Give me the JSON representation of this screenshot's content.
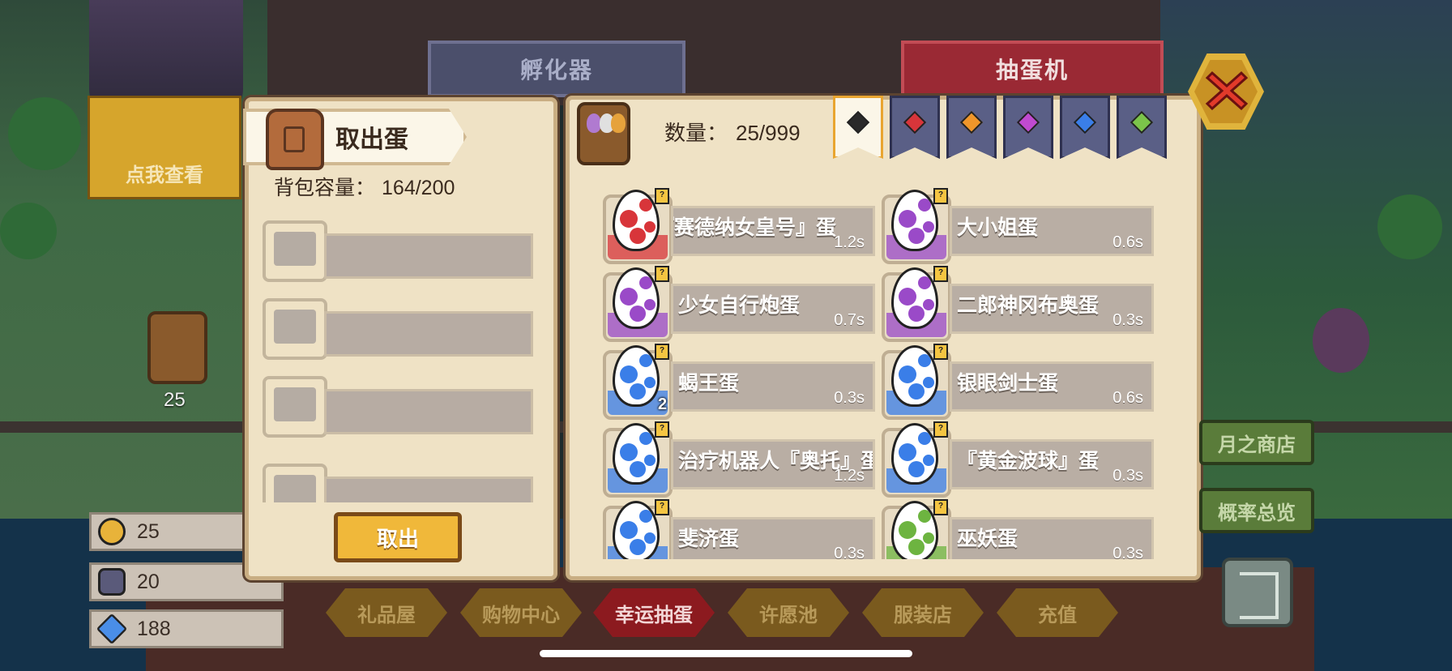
{
  "top_tabs": {
    "incubator": "孵化器",
    "gacha": "抽蛋机"
  },
  "left_panel": {
    "title": "取出蛋",
    "capacity_label": "背包容量：",
    "capacity_value": "164/200",
    "take_button": "取出",
    "slot_count": 4
  },
  "right_panel": {
    "quantity_label": "数量：",
    "quantity_value": "25/999",
    "filters": [
      {
        "icon": "all-rarity-icon",
        "color": "#2a2a2a",
        "active": true
      },
      {
        "icon": "red-gem-icon",
        "color": "#d8353a",
        "active": false
      },
      {
        "icon": "orange-gem-icon",
        "color": "#f0962a",
        "active": false
      },
      {
        "icon": "purple-gem-icon",
        "color": "#c04ad0",
        "active": false
      },
      {
        "icon": "blue-gem-icon",
        "color": "#3a7ee8",
        "active": false
      },
      {
        "icon": "green-gem-icon",
        "color": "#7bc44a",
        "active": false
      }
    ],
    "eggs": [
      {
        "name": "『赛德纳女皇号』蛋",
        "time": "1.2s",
        "color": "#d8353a",
        "count": ""
      },
      {
        "name": "大小姐蛋",
        "time": "0.6s",
        "color": "#9a4ac8",
        "count": ""
      },
      {
        "name": "少女自行炮蛋",
        "time": "0.7s",
        "color": "#9a4ac8",
        "count": ""
      },
      {
        "name": "二郎神冈布奥蛋",
        "time": "0.3s",
        "color": "#9a4ac8",
        "count": ""
      },
      {
        "name": "蝎王蛋",
        "time": "0.3s",
        "color": "#3a7ee8",
        "count": "2"
      },
      {
        "name": "银眼剑士蛋",
        "time": "0.6s",
        "color": "#3a7ee8",
        "count": ""
      },
      {
        "name": "治疗机器人『奥托』蛋",
        "time": "1.2s",
        "color": "#3a7ee8",
        "count": ""
      },
      {
        "name": "『黄金波球』蛋",
        "time": "0.3s",
        "color": "#3a7ee8",
        "count": ""
      },
      {
        "name": "斐济蛋",
        "time": "0.3s",
        "color": "#3a7ee8",
        "count": ""
      },
      {
        "name": "巫妖蛋",
        "time": "0.3s",
        "color": "#6db440",
        "count": ""
      }
    ]
  },
  "side_buttons": {
    "moon_shop": "月之商店",
    "probability": "概率总览"
  },
  "bottom_nav": [
    "礼品屋",
    "购物中心",
    "幸运抽蛋",
    "许愿池",
    "服装店",
    "充值"
  ],
  "bottom_nav_active": "幸运抽蛋",
  "resources": [
    {
      "icon": "golden-egg-icon",
      "value": "25"
    },
    {
      "icon": "helmet-token-icon",
      "value": "20"
    },
    {
      "icon": "diamond-icon",
      "value": "188"
    }
  ],
  "overlay": {
    "see_me": "点我查看",
    "basket_count": "25"
  }
}
